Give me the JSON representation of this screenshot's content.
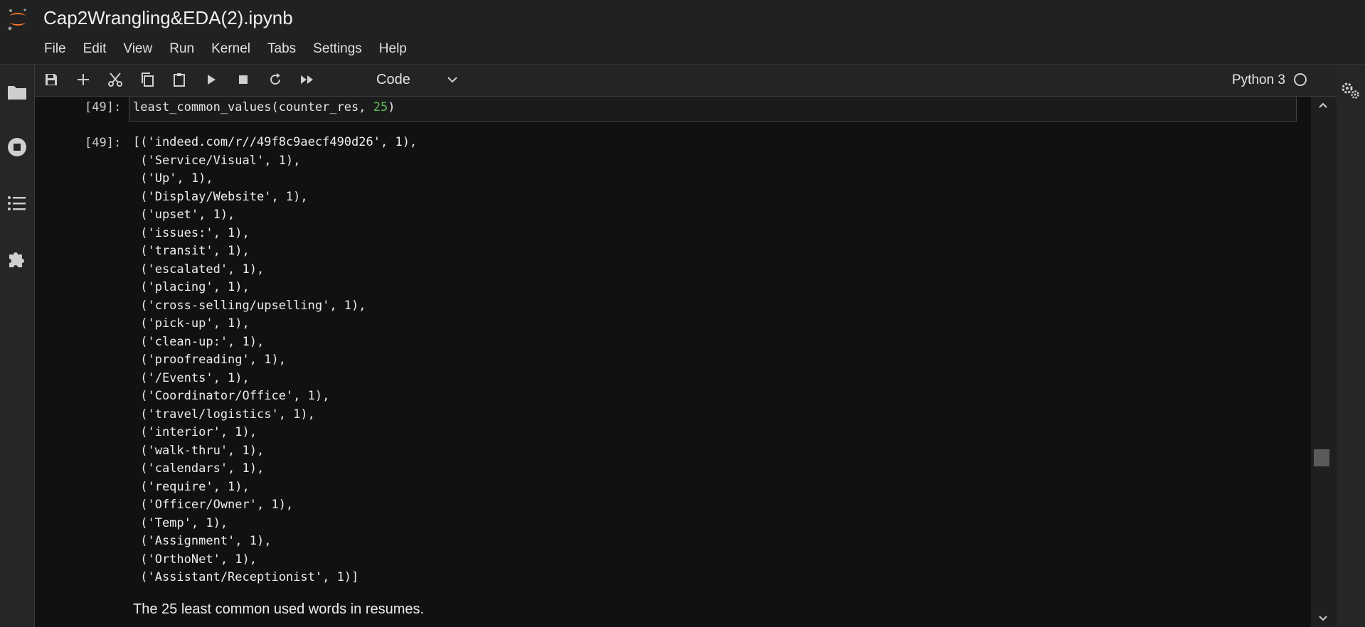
{
  "window": {
    "title": "Cap2Wrangling&EDA(2).ipynb"
  },
  "menu": [
    "File",
    "Edit",
    "View",
    "Run",
    "Kernel",
    "Tabs",
    "Settings",
    "Help"
  ],
  "toolbar": {
    "cell_type": "Code",
    "kernel": "Python 3"
  },
  "cell": {
    "input_prompt": "[49]:",
    "code_prefix": "least_common_values(counter_res, ",
    "code_number": "25",
    "code_suffix": ")",
    "output_prompt": "[49]:",
    "output_lines": [
      "[('indeed.com/r//49f8c9aecf490d26', 1),",
      " ('Service/Visual', 1),",
      " ('Up', 1),",
      " ('Display/Website', 1),",
      " ('upset', 1),",
      " ('issues:', 1),",
      " ('transit', 1),",
      " ('escalated', 1),",
      " ('placing', 1),",
      " ('cross-selling/upselling', 1),",
      " ('pick-up', 1),",
      " ('clean-up:', 1),",
      " ('proofreading', 1),",
      " ('/Events', 1),",
      " ('Coordinator/Office', 1),",
      " ('travel/logistics', 1),",
      " ('interior', 1),",
      " ('walk-thru', 1),",
      " ('calendars', 1),",
      " ('require', 1),",
      " ('Officer/Owner', 1),",
      " ('Temp', 1),",
      " ('Assignment', 1),",
      " ('OrthoNet', 1),",
      " ('Assistant/Receptionist', 1)]"
    ]
  },
  "markdown": {
    "text": "The 25 least common used words in resumes."
  },
  "icons": {
    "logo": "jupyter-logo-icon",
    "sidebar": [
      "folder-icon",
      "running-icon",
      "toc-icon",
      "extension-icon"
    ],
    "right": "property-inspector-icon"
  },
  "colors": {
    "accent": "#f37726",
    "number": "#5fb95f",
    "background": "#111111"
  }
}
